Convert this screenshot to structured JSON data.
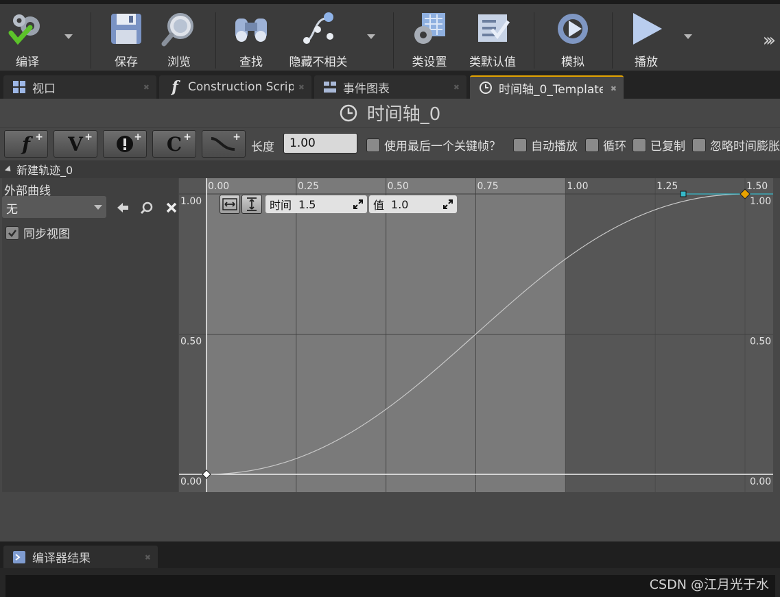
{
  "toolbar": {
    "items": [
      {
        "label": "编译",
        "icon": "compile-gear-check-icon"
      },
      {
        "label": "保存",
        "icon": "save-floppy-icon"
      },
      {
        "label": "浏览",
        "icon": "browse-magnifier-icon"
      },
      {
        "label": "查找",
        "icon": "find-binoculars-icon"
      },
      {
        "label": "隐藏不相关",
        "icon": "hide-unrelated-icon"
      },
      {
        "label": "类设置",
        "icon": "class-settings-icon"
      },
      {
        "label": "类默认值",
        "icon": "class-defaults-icon"
      },
      {
        "label": "模拟",
        "icon": "simulate-icon"
      },
      {
        "label": "播放",
        "icon": "play-icon"
      }
    ]
  },
  "tabs": [
    {
      "label": "视口",
      "icon": "viewport-grid-icon"
    },
    {
      "label": "Construction Script",
      "icon": "function-f-icon"
    },
    {
      "label": "事件图表",
      "icon": "event-graph-icon"
    },
    {
      "label": "时间轴_0_Template",
      "icon": "clock-icon",
      "active": true
    }
  ],
  "timeline": {
    "title": "时间轴_0",
    "tool_buttons": [
      {
        "glyph": "f",
        "name": "add-float-track"
      },
      {
        "glyph": "V",
        "name": "add-vector-track"
      },
      {
        "glyph": "!",
        "name": "add-event-track"
      },
      {
        "glyph": "C",
        "name": "add-color-track"
      },
      {
        "glyph": "~",
        "name": "add-external-curve"
      }
    ],
    "length_label": "长度",
    "length_value": "1.00",
    "options": [
      "使用最后一个关键帧？",
      "自动播放",
      "循环",
      "已复制",
      "忽略时间膨胀"
    ],
    "track_name": "新建轨迹_0",
    "external_curve_label": "外部曲线",
    "external_curve_value": "无",
    "sync_view_label": "同步视图",
    "sync_view_checked": true
  },
  "keyframe_editor": {
    "time_label": "时间",
    "time_value": "1.5",
    "value_label": "值",
    "value_value": "1.0"
  },
  "chart_data": {
    "type": "line",
    "x_ticks": [
      "0.00",
      "0.25",
      "0.50",
      "0.75",
      "1.00",
      "1.25",
      "1.50"
    ],
    "y_ticks": [
      "1.00",
      "0.50",
      "0.00"
    ],
    "xlim": [
      0,
      1.5
    ],
    "ylim": [
      0,
      1
    ],
    "active_range": [
      0,
      1.0
    ],
    "keys": [
      {
        "time": 0.0,
        "value": 0.0
      },
      {
        "time": 1.5,
        "value": 1.0
      }
    ],
    "interpolation": "cubic",
    "selected_key_color": "#e8a200",
    "tangent_color": "#36b8c8"
  },
  "bottom": {
    "tab_label": "编译器结果",
    "watermark": "CSDN @江月光于水"
  }
}
